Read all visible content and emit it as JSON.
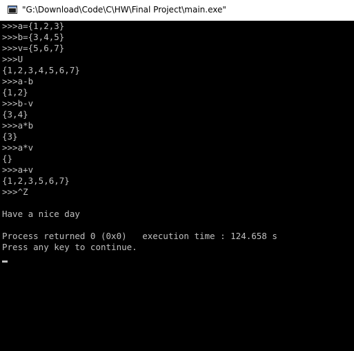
{
  "window": {
    "title": "\"G:\\Download\\Code\\C\\HW\\Final Project\\main.exe\""
  },
  "console": {
    "lines": [
      ">>>a={1,2,3}",
      ">>>b={3,4,5}",
      ">>>v={5,6,7}",
      ">>>U",
      "{1,2,3,4,5,6,7}",
      ">>>a-b",
      "{1,2}",
      ">>>b-v",
      "{3,4}",
      ">>>a*b",
      "{3}",
      ">>>a*v",
      "{}",
      ">>>a+v",
      "{1,2,3,5,6,7}",
      ">>>^Z",
      "",
      "Have a nice day",
      "",
      "Process returned 0 (0x0)   execution time : 124.658 s",
      "Press any key to continue."
    ]
  },
  "colors": {
    "console_background": "#000000",
    "console_text": "#c0c0c0",
    "titlebar_background": "#ffffff"
  },
  "icons": {
    "title_icon": "console-app-icon"
  }
}
